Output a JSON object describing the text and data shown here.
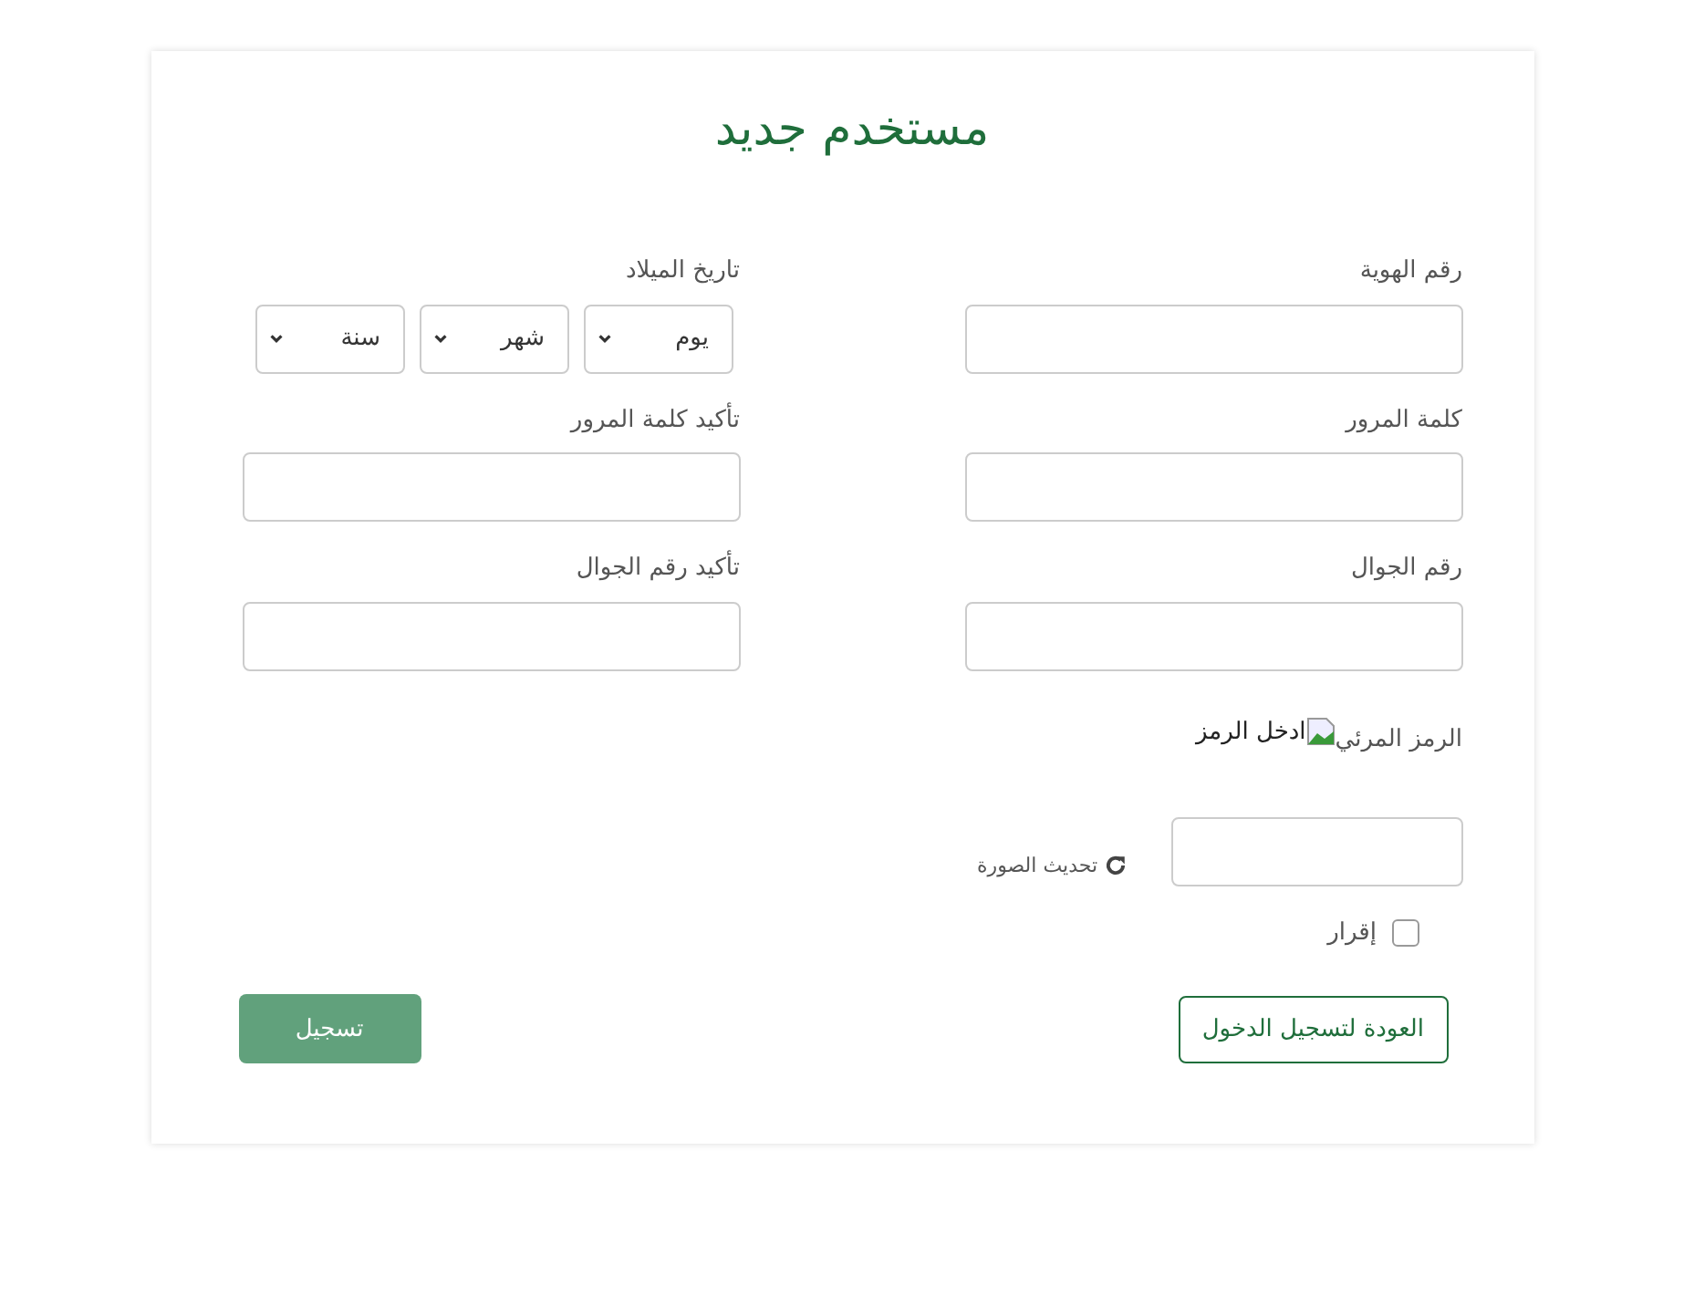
{
  "title": "مستخدم جديد",
  "fields": [
    {
      "kind": "input",
      "label": "رقم الهوية"
    },
    {
      "kind": "date",
      "label": "تاريخ الميلاد",
      "selects": [
        "يوم",
        "شهر",
        "سنة"
      ]
    },
    {
      "kind": "input",
      "label": "كلمة المرور"
    },
    {
      "kind": "input",
      "label": "تأكيد كلمة المرور"
    },
    {
      "kind": "input",
      "label": "رقم الجوال"
    },
    {
      "kind": "input",
      "label": "تأكيد رقم الجوال"
    }
  ],
  "captcha": {
    "label": "الرمز المرئي",
    "image_alt": "ادخل الرمز",
    "refresh": "تحديث الصورة"
  },
  "agreement": {
    "label": "إقرار",
    "checked": false
  },
  "back_button": "العودة لتسجيل الدخول",
  "submit_button": {
    "label": "تسجيل",
    "disabled": true
  }
}
